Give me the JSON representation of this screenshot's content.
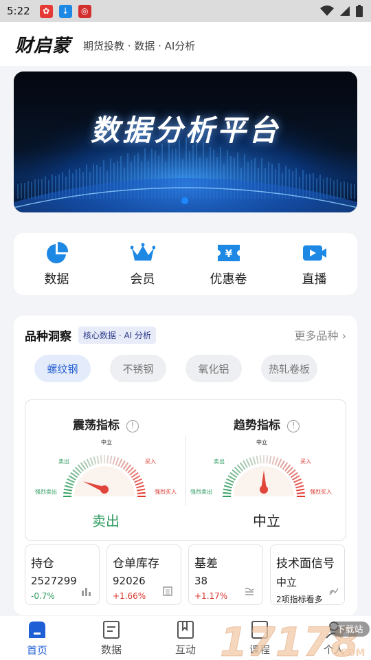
{
  "status_bar": {
    "time": "5:22"
  },
  "header": {
    "brand": "财启蒙",
    "tagline": "期货投教 · 数据 · AI分析"
  },
  "banner": {
    "title": "数据分析平台"
  },
  "quick_nav": [
    {
      "label": "数据",
      "icon": "pie-chart-icon"
    },
    {
      "label": "会员",
      "icon": "crown-icon"
    },
    {
      "label": "优惠卷",
      "icon": "coupon-icon"
    },
    {
      "label": "直播",
      "icon": "live-icon"
    }
  ],
  "variety": {
    "title": "品种洞察",
    "badge": "核心数据 · AI 分析",
    "more": "更多品种",
    "chips": [
      "螺纹钢",
      "不锈钢",
      "氧化铝",
      "热轧卷板"
    ],
    "active_chip": "螺纹钢"
  },
  "gauges": [
    {
      "title": "震荡指标",
      "labels": {
        "top": "中立",
        "sell": "卖出",
        "buy": "买入",
        "strong_sell": "强烈卖出",
        "strong_buy": "强烈买入"
      },
      "result": "卖出",
      "result_color": "#2e9a5f"
    },
    {
      "title": "趋势指标",
      "labels": {
        "top": "中立",
        "sell": "卖出",
        "buy": "买入",
        "strong_sell": "强烈卖出",
        "strong_buy": "强烈买入"
      },
      "result": "中立",
      "result_color": "#222222"
    }
  ],
  "stats": [
    {
      "name": "持仓",
      "value": "2527299",
      "change": "-0.7%",
      "change_color": "#2e9a5f",
      "icon": "bar-chart-icon"
    },
    {
      "name": "仓单库存",
      "value": "92026",
      "change": "+1.66%",
      "change_color": "#d9342b",
      "icon": "list-icon"
    },
    {
      "name": "基差",
      "value": "38",
      "change": "+1.17%",
      "change_color": "#d9342b",
      "icon": "wave-icon"
    },
    {
      "name": "技术面信号",
      "value": "中立",
      "change": "2项指标看多",
      "change_color": "#222222",
      "icon": "trend-icon"
    }
  ],
  "tabs": [
    {
      "label": "首页",
      "icon": "home-icon",
      "active": true
    },
    {
      "label": "数据",
      "icon": "document-icon",
      "active": false
    },
    {
      "label": "互动",
      "icon": "book-icon",
      "active": false
    },
    {
      "label": "课程",
      "icon": "course-icon",
      "active": false
    },
    {
      "label": "个人",
      "icon": "user-icon",
      "active": false
    }
  ],
  "watermark": {
    "number": "17178",
    "suffix": ".COM",
    "tag": "下载站"
  },
  "colors": {
    "accent": "#1f5fd6",
    "icon_blue": "#1e88e5",
    "sell": "#2e9a5f",
    "buy": "#d9342b"
  }
}
